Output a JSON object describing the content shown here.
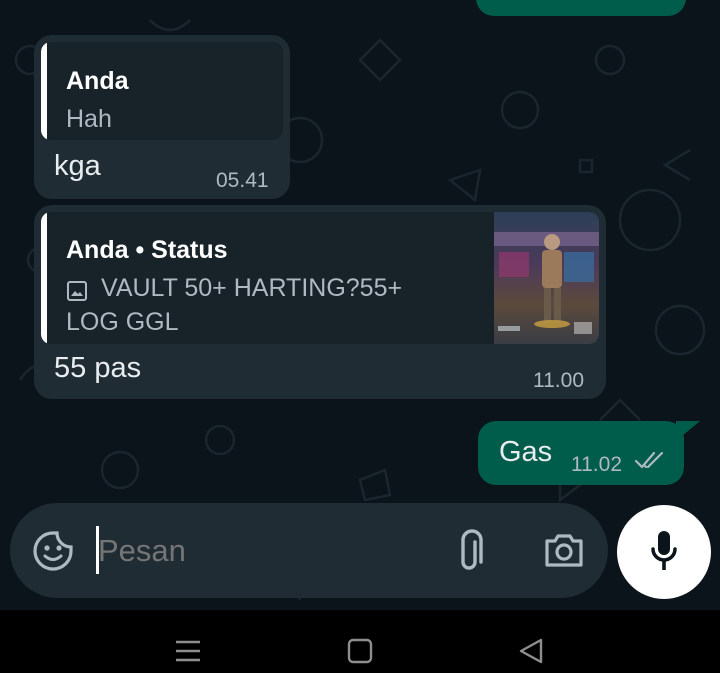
{
  "messages": [
    {
      "quote_name": "Anda",
      "quote_text": "Hah",
      "text": "kga",
      "time": "05.41"
    },
    {
      "quote_name": "Anda • Status",
      "quote_text_line1": "VAULT 50+ HARTING?55+",
      "quote_text_line2": "LOG GGL",
      "text": "55 pas",
      "time": "11.00"
    },
    {
      "text": "Gas",
      "time": "11.02",
      "status_icon": "double-check-icon"
    }
  ],
  "composer": {
    "placeholder": "Pesan",
    "left_icon": "sticker-icon",
    "attach_icon": "paperclip-icon",
    "camera_icon": "camera-icon",
    "send_icon": "mic-icon"
  },
  "nav": {
    "icons": [
      "menu-icon",
      "home-icon",
      "back-icon"
    ]
  },
  "colors": {
    "background": "#0b141a",
    "incoming_bubble": "#1f2c34",
    "outgoing_bubble": "#005c4b",
    "quote_bg": "#182229"
  }
}
